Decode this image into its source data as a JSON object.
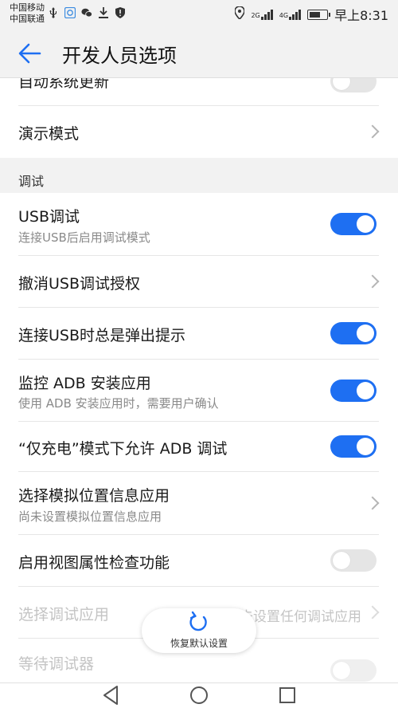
{
  "status_bar": {
    "carrier_1": "中国移动",
    "carrier_2": "中国联通",
    "signal_1_label": "2G",
    "signal_2_label": "4G",
    "time": "早上8:31",
    "battery_percent": 70,
    "icons": [
      "usb-icon",
      "app-icon",
      "wechat-icon",
      "download-icon",
      "shield-icon",
      "location-icon",
      "signal-icon",
      "battery-icon"
    ]
  },
  "app_bar": {
    "title": "开发人员选项",
    "back_icon": "arrow-left-icon"
  },
  "top_partial_item": {
    "label": "自动系统更新",
    "toggle_on": false
  },
  "demo_mode": {
    "label": "演示模式"
  },
  "section_debug": {
    "title": "调试"
  },
  "items": {
    "usb_debugging": {
      "label": "USB调试",
      "subtitle": "连接USB后启用调试模式",
      "toggle_on": true
    },
    "revoke_usb": {
      "label": "撤消USB调试授权"
    },
    "usb_prompt": {
      "label": "连接USB时总是弹出提示",
      "toggle_on": true
    },
    "monitor_adb": {
      "label": "监控 ADB 安装应用",
      "subtitle": "使用 ADB 安装应用时，需要用户确认",
      "toggle_on": true
    },
    "charge_only_adb": {
      "label": "“仅充电”模式下允许 ADB 调试",
      "toggle_on": true
    },
    "mock_location": {
      "label": "选择模拟位置信息应用",
      "subtitle": "尚未设置模拟位置信息应用"
    },
    "view_attr": {
      "label": "启用视图属性检查功能",
      "toggle_on": false
    },
    "debug_app": {
      "label": "选择调试应用",
      "value": "未设置任何调试应用"
    },
    "wait_debugger": {
      "label": "等待调试器"
    }
  },
  "fab": {
    "label": "恢复默认设置",
    "icon": "refresh-icon"
  },
  "colors": {
    "accent": "#1e6ff2",
    "toggle_off": "#e5e5e5",
    "section_bg": "#f2f2f2"
  }
}
